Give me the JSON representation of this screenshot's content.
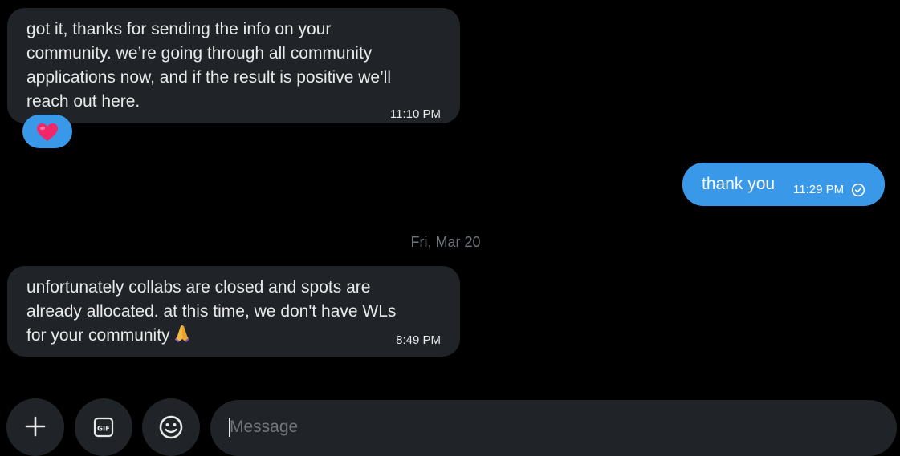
{
  "messages": [
    {
      "direction": "incoming",
      "text": "got it, thanks for sending the info on your\ncommunity. we’re going through all community\napplications now, and if the result is positive we’ll\nreach out here.",
      "time": "11:10 PM",
      "reaction": "heart-emoji"
    },
    {
      "direction": "outgoing",
      "text": "thank you",
      "time": "11:29 PM",
      "status_icon": "check-circle-icon"
    },
    {
      "direction": "incoming",
      "text": "unfortunately collabs are closed and spots are\nalready allocated. at this time, we don't have WLs\nfor your community",
      "time": "8:49 PM",
      "trailing_emoji": "folded-hands-emoji"
    }
  ],
  "date_separator": "Fri, Mar 20",
  "composer": {
    "placeholder": "Message",
    "value": "",
    "buttons": [
      "add-icon",
      "gif-icon",
      "emoji-icon"
    ]
  },
  "colors": {
    "background": "#000000",
    "incoming_bubble": "#202327",
    "outgoing_bubble": "#3a98e8",
    "muted_text": "#71767b"
  }
}
